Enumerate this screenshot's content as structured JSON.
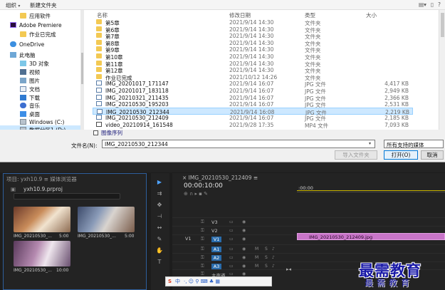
{
  "dialog": {
    "toolbar": {
      "organize": "组织",
      "new_folder": "新建文件夹"
    },
    "nav_items": [
      {
        "label": "应用软件",
        "icon": "folder-icon"
      },
      {
        "label": "Adobe Premiere",
        "icon": "premiere-icon"
      },
      {
        "label": "作业已完成",
        "icon": "folder-icon"
      },
      {
        "label": "OneDrive",
        "icon": "onedrive-icon"
      },
      {
        "label": "此电脑",
        "icon": "computer-icon"
      },
      {
        "label": "3D 对象",
        "icon": "3d-objects-icon"
      },
      {
        "label": "视频",
        "icon": "videos-icon"
      },
      {
        "label": "图片",
        "icon": "pictures-icon"
      },
      {
        "label": "文档",
        "icon": "documents-icon"
      },
      {
        "label": "下载",
        "icon": "downloads-icon"
      },
      {
        "label": "音乐",
        "icon": "music-icon"
      },
      {
        "label": "桌面",
        "icon": "desktop-icon"
      },
      {
        "label": "Windows (C:)",
        "icon": "drive-icon"
      },
      {
        "label": "数据分区1 (D:)",
        "icon": "drive-icon"
      }
    ],
    "columns": {
      "name": "名称",
      "date": "修改日期",
      "type": "类型",
      "size": "大小"
    },
    "files": [
      {
        "name": "第5章",
        "date": "2021/9/14 14:30",
        "type": "文件夹",
        "size": "",
        "kind": "folder"
      },
      {
        "name": "第6章",
        "date": "2021/9/14 14:30",
        "type": "文件夹",
        "size": "",
        "kind": "folder"
      },
      {
        "name": "第7章",
        "date": "2021/9/14 14:30",
        "type": "文件夹",
        "size": "",
        "kind": "folder"
      },
      {
        "name": "第8章",
        "date": "2021/9/14 14:30",
        "type": "文件夹",
        "size": "",
        "kind": "folder"
      },
      {
        "name": "第9章",
        "date": "2021/9/14 14:30",
        "type": "文件夹",
        "size": "",
        "kind": "folder"
      },
      {
        "name": "第10章",
        "date": "2021/9/14 14:30",
        "type": "文件夹",
        "size": "",
        "kind": "folder"
      },
      {
        "name": "第11章",
        "date": "2021/9/14 14:30",
        "type": "文件夹",
        "size": "",
        "kind": "folder"
      },
      {
        "name": "第12章",
        "date": "2021/9/14 14:30",
        "type": "文件夹",
        "size": "",
        "kind": "folder"
      },
      {
        "name": "作业已完成",
        "date": "2021/10/12 14:26",
        "type": "文件夹",
        "size": "",
        "kind": "folder"
      },
      {
        "name": "IMG_20201017_171147",
        "date": "2021/9/14 16:07",
        "type": "JPG 文件",
        "size": "4,417 KB",
        "kind": "img"
      },
      {
        "name": "IMG_20201017_183118",
        "date": "2021/9/14 16:07",
        "type": "JPG 文件",
        "size": "2,949 KB",
        "kind": "img"
      },
      {
        "name": "IMG_20210321_211435",
        "date": "2021/9/14 16:07",
        "type": "JPG 文件",
        "size": "2,366 KB",
        "kind": "img"
      },
      {
        "name": "IMG_20210530_195203",
        "date": "2021/9/14 16:07",
        "type": "JPG 文件",
        "size": "2,531 KB",
        "kind": "img"
      },
      {
        "name": "IMG_20210530_212344",
        "date": "2021/9/14 16:08",
        "type": "JPG 文件",
        "size": "2,219 KB",
        "kind": "img",
        "selected": true
      },
      {
        "name": "IMG_20210530_212409",
        "date": "2021/9/14 16:07",
        "type": "JPG 文件",
        "size": "2,185 KB",
        "kind": "img"
      },
      {
        "name": "video_20210914_161548",
        "date": "2021/9/28 17:35",
        "type": "MP4 文件",
        "size": "7,093 KB",
        "kind": "vid"
      }
    ],
    "image_sequence_label": "图像序列",
    "filename_label": "文件名(N):",
    "filename_value": "IMG_20210530_212344",
    "file_type_value": "所有支持的媒体",
    "import_folder_button": "导入文件夹",
    "open_button": "打开(O)",
    "cancel_button": "取消"
  },
  "project": {
    "tab_label": "项目: yxh10.9 ≡  媒体浏览器",
    "project_file": "yxh10.9.prproj",
    "clips": [
      {
        "name": "IMG_20210530_...",
        "duration": "5:00"
      },
      {
        "name": "IMG_20210530_...",
        "duration": "5:00"
      },
      {
        "name": "IMG_20210530_...",
        "duration": "10:00"
      }
    ]
  },
  "timeline": {
    "tab_label": "× IMG_20210530_212409 ≡",
    "timecode": "00:00:10:00",
    "ruler_label": ":00:00",
    "source_label": "V1",
    "tracks": [
      {
        "name": "V3",
        "on": false
      },
      {
        "name": "V2",
        "on": false
      },
      {
        "name": "V1",
        "on": true
      },
      {
        "name": "A1",
        "on": true
      },
      {
        "name": "A2",
        "on": true
      },
      {
        "name": "A3",
        "on": true
      },
      {
        "name": "主声道",
        "on": false
      }
    ],
    "clip_label": "IMG_20210530_212409.jpg"
  },
  "ime": {
    "logo": "S",
    "lang": "中",
    "symbols": "·, ☺ ⚲ ⌨ ♣ ▦"
  },
  "watermark": {
    "main": "最需教育",
    "sub": "最需教育"
  }
}
